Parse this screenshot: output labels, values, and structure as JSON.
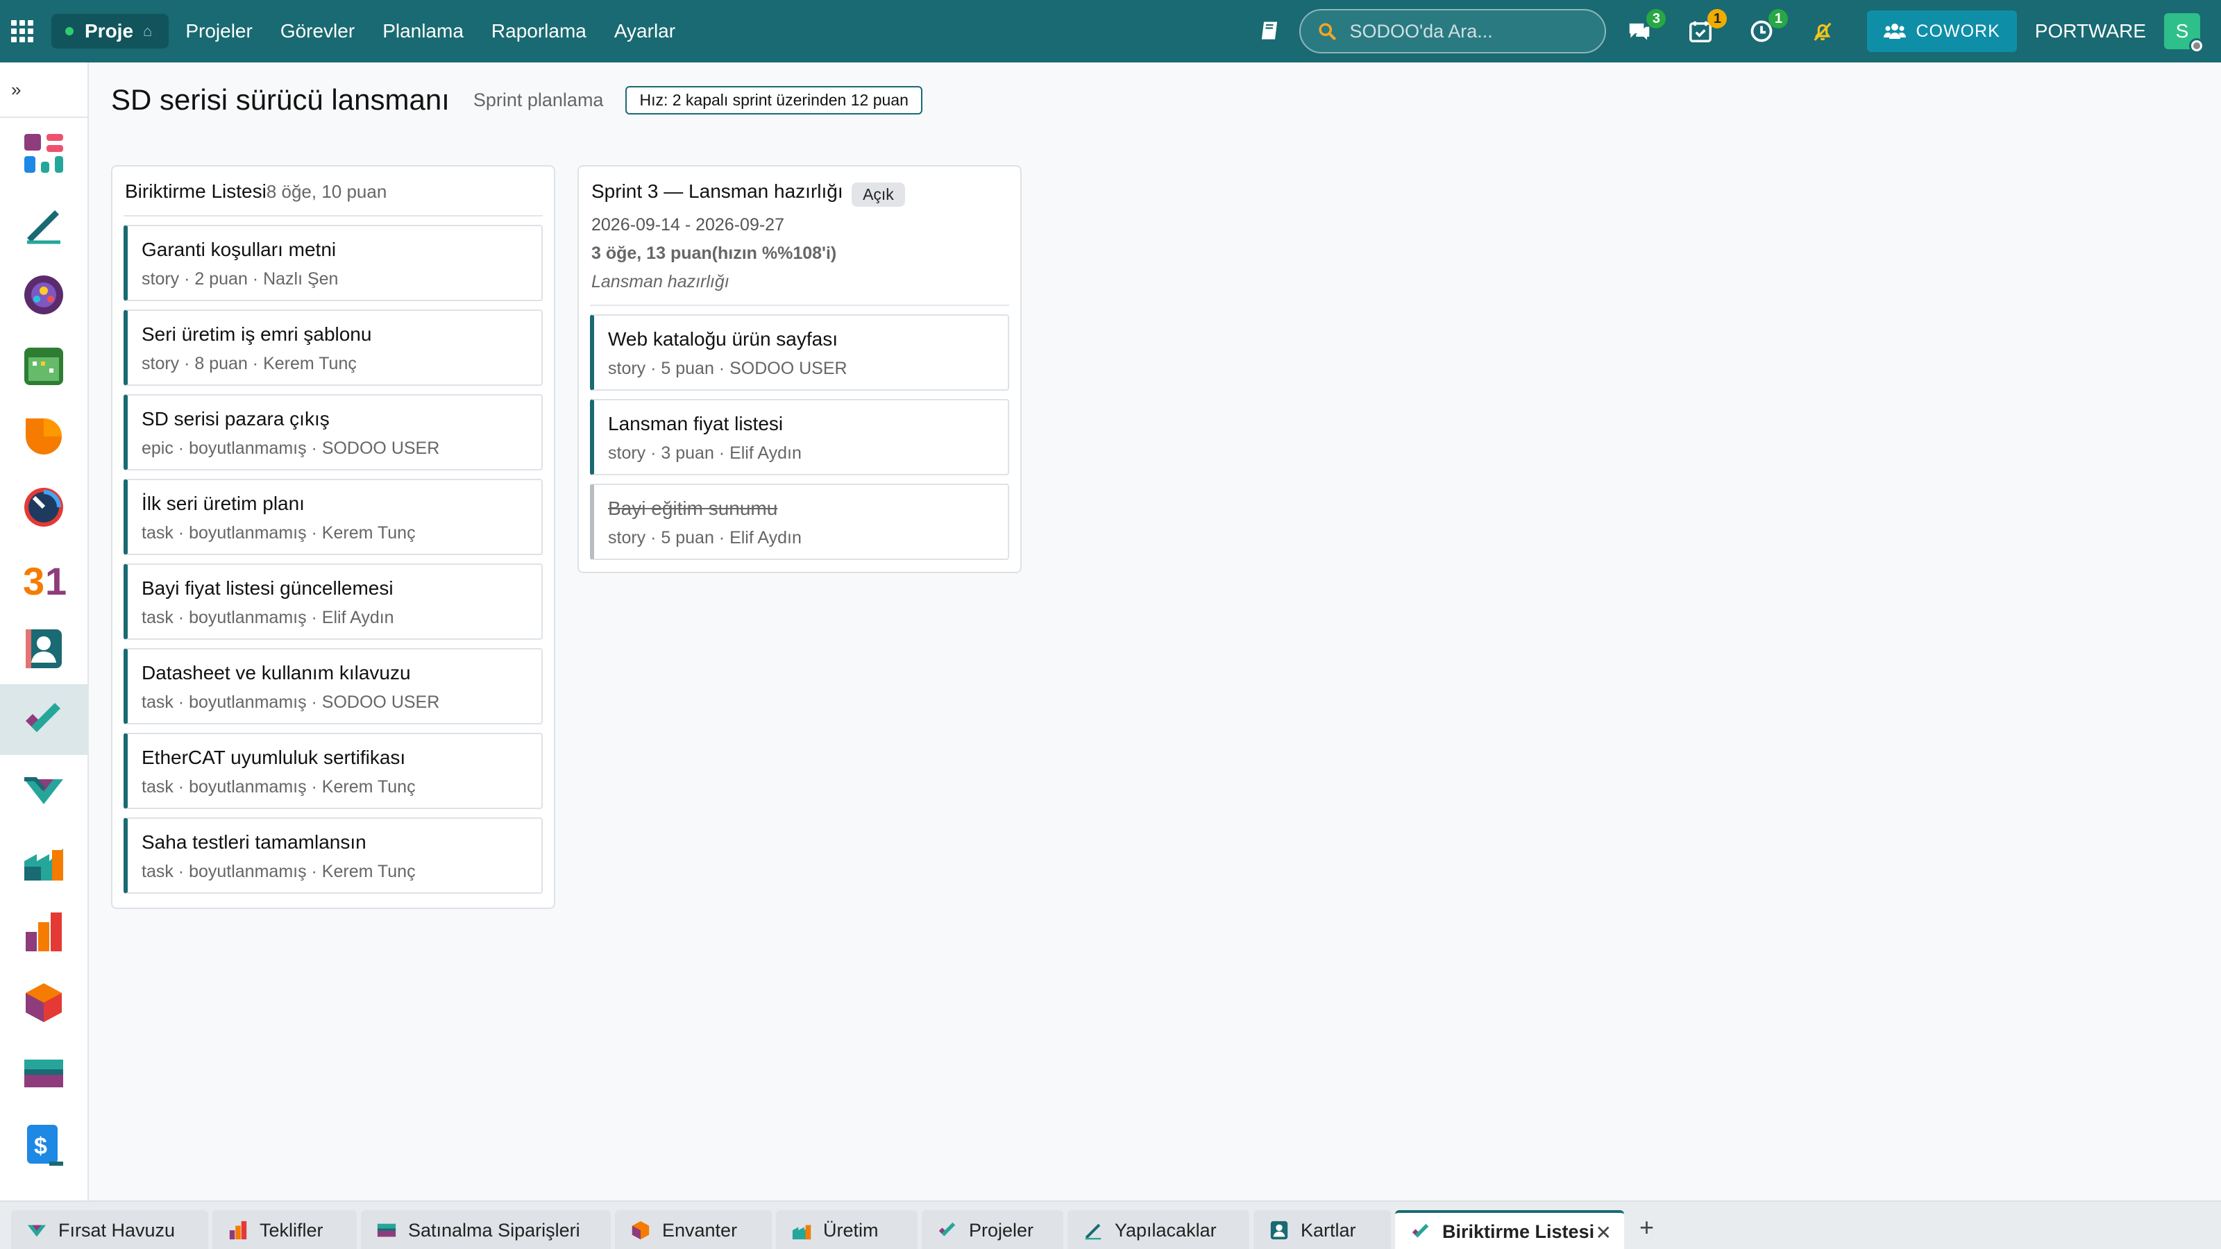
{
  "topbar": {
    "app_name": "Proje",
    "menu": [
      "Projeler",
      "Görevler",
      "Planlama",
      "Raporlama",
      "Ayarlar"
    ],
    "search_placeholder": "SODOO'da Ara...",
    "messages_count": "3",
    "activities_count": "1",
    "timer_count": "1",
    "cowork_label": "COWORK",
    "company": "PORTWARE",
    "avatar_initial": "S",
    "colors": {
      "nav": "#196a72",
      "cowork": "#0f8ea8"
    }
  },
  "sidebar": {
    "expand_icon": "»",
    "apps": [
      "dashboard-icon",
      "notes-icon",
      "community-icon",
      "calendar-icon",
      "crm-icon",
      "timer-icon",
      "events-icon",
      "contacts-icon",
      "project-icon",
      "pipeline-icon",
      "production-icon",
      "quotes-icon",
      "inventory-icon",
      "purchase-icon",
      "invoice-icon"
    ]
  },
  "page": {
    "title": "SD serisi sürücü lansmanı",
    "subtitle": "Sprint planlama",
    "velocity": "Hız: 2 kapalı sprint üzerinden 12 puan"
  },
  "backlog": {
    "title": "Biriktirme Listesi",
    "meta": "8 öğe, 10 puan",
    "cards": [
      {
        "title": "Garanti koşulları metni",
        "meta": "story · 2 puan · Nazlı Şen"
      },
      {
        "title": "Seri üretim iş emri şablonu",
        "meta": "story · 8 puan · Kerem Tunç"
      },
      {
        "title": "SD serisi pazara çıkış",
        "meta": "epic · boyutlanmamış · SODOO USER"
      },
      {
        "title": "İlk seri üretim planı",
        "meta": "task · boyutlanmamış · Kerem Tunç"
      },
      {
        "title": "Bayi fiyat listesi güncellemesi",
        "meta": "task · boyutlanmamış · Elif Aydın"
      },
      {
        "title": "Datasheet ve kullanım kılavuzu",
        "meta": "task · boyutlanmamış · SODOO USER"
      },
      {
        "title": "EtherCAT uyumluluk sertifikası",
        "meta": "task · boyutlanmamış · Kerem Tunç"
      },
      {
        "title": "Saha testleri tamamlansın",
        "meta": "task · boyutlanmamış · Kerem Tunç"
      }
    ]
  },
  "sprint": {
    "title": "Sprint 3 — Lansman hazırlığı",
    "status": "Açık",
    "dates": "2026-09-14 - 2026-09-27",
    "stats": "3 öğe, 13 puan(hızın %%108'i)",
    "goal": "Lansman hazırlığı",
    "cards": [
      {
        "title": "Web kataloğu ürün sayfası",
        "meta": "story · 5 puan · SODOO USER"
      },
      {
        "title": "Lansman fiyat listesi",
        "meta": "story · 3 puan · Elif Aydın"
      },
      {
        "title": "Bayi eğitim sunumu",
        "meta": "story · 5 puan · Elif Aydın",
        "done": true
      }
    ]
  },
  "tabs": [
    {
      "label": "Fırsat Havuzu",
      "icon": "pipeline-icon"
    },
    {
      "label": "Teklifler",
      "icon": "quotes-icon"
    },
    {
      "label": "Satınalma Siparişleri",
      "icon": "purchase-icon"
    },
    {
      "label": "Envanter",
      "icon": "inventory-icon"
    },
    {
      "label": "Üretim",
      "icon": "production-icon"
    },
    {
      "label": "Projeler",
      "icon": "project-icon"
    },
    {
      "label": "Yapılacaklar",
      "icon": "notes-icon"
    },
    {
      "label": "Kartlar",
      "icon": "contacts-icon"
    },
    {
      "label": "Biriktirme Listesi",
      "icon": "project-icon",
      "active": true
    }
  ]
}
